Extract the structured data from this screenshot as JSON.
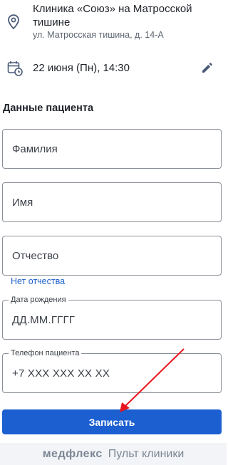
{
  "clinic": {
    "icon": "location-pin-icon",
    "name": "Клиника «Союз» на Матросской тишине",
    "address": "ул. Матросская тишина, д. 14-А"
  },
  "appointment": {
    "icon": "calendar-clock-icon",
    "datetime": "22 июня (Пн), 14:30",
    "edit_icon": "pencil-icon"
  },
  "patient_section": {
    "title": "Данные пациента",
    "surname_placeholder": "Фамилия",
    "name_placeholder": "Имя",
    "patronymic_placeholder": "Отчество",
    "no_patronymic_link": "Нет отчества",
    "birthdate_label": "Дата рождения",
    "birthdate_placeholder": "ДД.ММ.ГГГГ",
    "phone_label": "Телефон пациента",
    "phone_placeholder": "+7 XXX XXX XX XX"
  },
  "submit_label": "Записать",
  "footer": {
    "brand": "медфлекс",
    "product": "Пульт клиники"
  },
  "colors": {
    "accent": "#1b5fd0",
    "link": "#1d5fcc",
    "annotation_arrow": "#e8141c",
    "footer_bg": "#f2f4f7"
  }
}
